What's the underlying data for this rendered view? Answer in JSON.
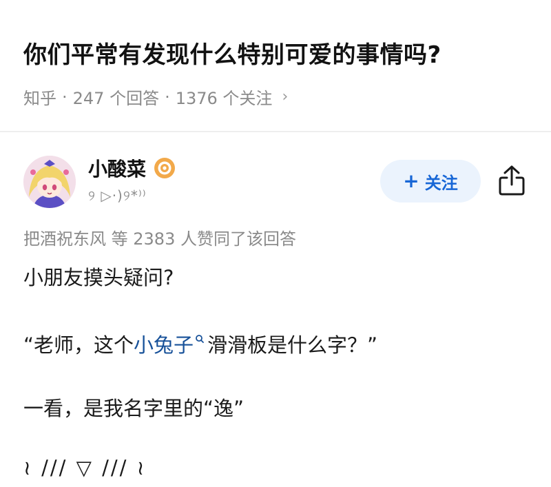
{
  "question": {
    "title": "你们平常有发现什么特别可爱的事情吗?",
    "source": "知乎",
    "answers_count": "247 个回答",
    "followers_count": "1376 个关注",
    "separator": "·",
    "chevron": "›"
  },
  "author": {
    "name": "小酸菜",
    "signature": "୨ ▷·)୨*⁾⁾",
    "avatar_icon": "anime-avatar-icon",
    "badge_icon": "bullseye-badge-icon"
  },
  "actions": {
    "follow_plus": "+",
    "follow_label": "关注",
    "share_icon": "share-icon"
  },
  "upvote_line": "把酒祝东风 等 2383 人赞同了该回答",
  "answer": {
    "line1": "小朋友摸头疑问?",
    "line2_prefix": "“老师，这个",
    "line2_link": "小兔子",
    "line2_suffix": "滑滑板是什么字？”",
    "line3": "一看，是我名字里的“逸”",
    "line4": "≀ /// ▽ /// ≀"
  },
  "colors": {
    "accent": "#1766d6",
    "follow_bg": "#ebf3fd",
    "link": "#175199",
    "meta_gray": "#8a8a8a"
  }
}
